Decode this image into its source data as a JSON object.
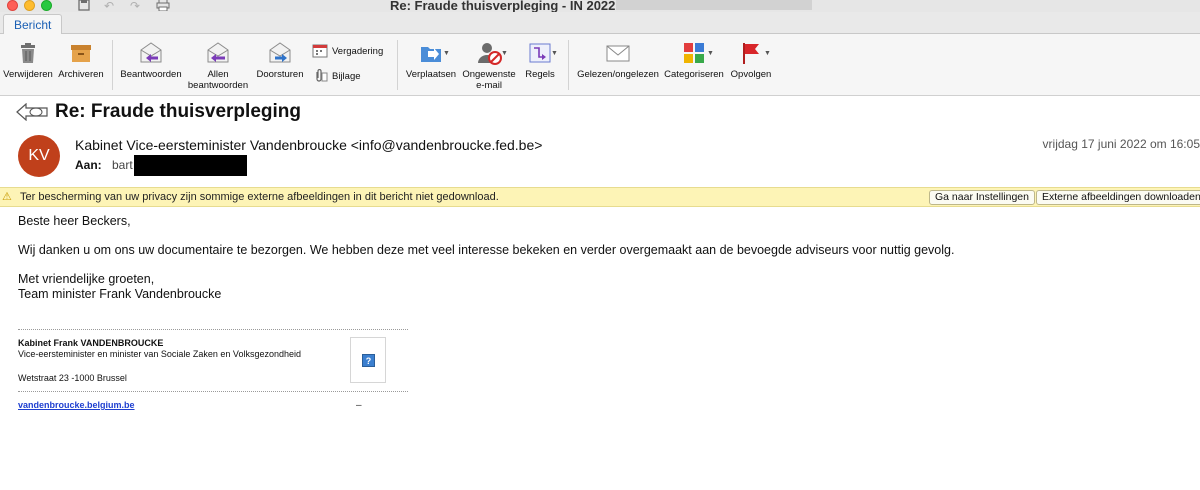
{
  "window": {
    "title": "Re: Fraude thuisverpleging - IN 2022 •"
  },
  "ribbon": {
    "active_tab": "Bericht"
  },
  "toolbar": {
    "delete": "Verwijderen",
    "archive": "Archiveren",
    "reply": "Beantwoorden",
    "reply_all_line1": "Allen",
    "reply_all_line2": "beantwoorden",
    "forward": "Doorsturen",
    "meeting": "Vergadering",
    "attachment": "Bijlage",
    "move": "Verplaatsen",
    "junk_line1": "Ongewenste",
    "junk_line2": "e-mail",
    "rules": "Regels",
    "read_unread": "Gelezen/ongelezen",
    "categorize": "Categoriseren",
    "follow_up": "Opvolgen"
  },
  "message": {
    "subject": "Re: Fraude thuisverpleging",
    "avatar_initials": "KV",
    "sender": "Kabinet Vice-eersteminister Vandenbroucke <info@vandenbroucke.fed.be>",
    "date": "vrijdag 17 juni 2022 om 16:05",
    "to_label": "Aan:",
    "to_value": "bart"
  },
  "privacy_bar": {
    "text": "Ter bescherming van uw privacy zijn sommige externe afbeeldingen in dit bericht niet gedownload.",
    "settings_button": "Ga naar Instellingen",
    "download_button": "Externe afbeeldingen downloaden"
  },
  "body": {
    "greeting": "Beste heer Beckers,",
    "paragraph": "Wij danken u om ons uw documentaire te bezorgen. We hebben deze met veel interesse bekeken en verder overgemaakt aan de bevoegde adviseurs voor nuttig gevolg.",
    "closing": "Met vriendelijke groeten,",
    "signoff": "Team minister Frank Vandenbroucke"
  },
  "signature": {
    "name": "Kabinet Frank VANDENBROUCKE",
    "role": "Vice-eersteminister en minister van Sociale Zaken en Volksgezondheid",
    "address": "Wetstraat 23 -1000 Brussel",
    "link": "vandenbroucke.belgium.be",
    "dash": "–",
    "image_placeholder": "?"
  },
  "colors": {
    "avatar": "#c0401b",
    "privacy_bar": "#fdf4b6",
    "link": "#1e3fd0"
  }
}
